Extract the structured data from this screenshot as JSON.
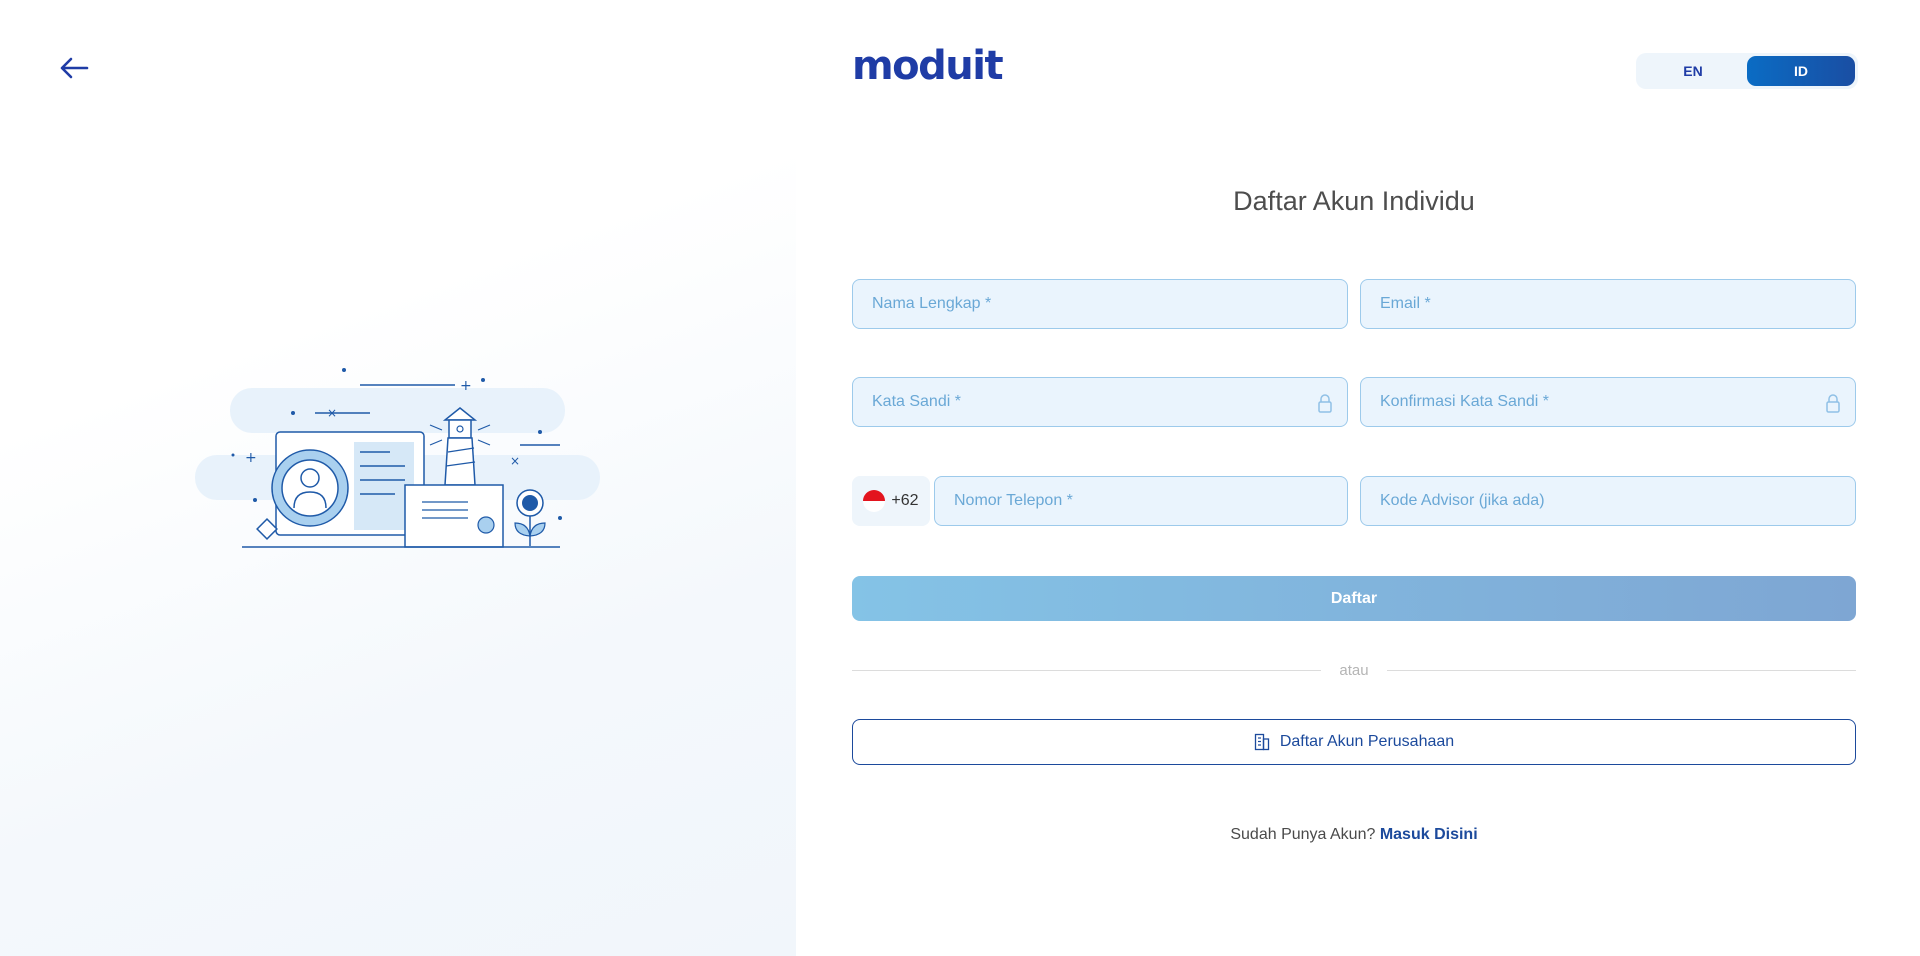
{
  "header": {
    "brand": "moduit",
    "languages": [
      {
        "label": "EN",
        "active": false
      },
      {
        "label": "ID",
        "active": true
      }
    ]
  },
  "form": {
    "title": "Daftar Akun Individu",
    "full_name_placeholder": "Nama Lengkap *",
    "email_placeholder": "Email *",
    "password_placeholder": "Kata Sandi *",
    "confirm_password_placeholder": "Konfirmasi Kata Sandi *",
    "country_code": "+62",
    "phone_placeholder": "Nomor Telepon *",
    "advisor_placeholder": "Kode Advisor (jika ada)",
    "submit_label": "Daftar",
    "divider_label": "atau",
    "company_button_label": "Daftar Akun Perusahaan",
    "login_prompt": "Sudah Punya Akun?",
    "login_link": "Masuk Disini"
  },
  "colors": {
    "brand_blue": "#1f3ca6",
    "input_bg": "#eaf4fd",
    "input_border": "#9dcaeb",
    "placeholder": "#6aa8d6",
    "submit_disabled": "#84c3e6"
  },
  "icons": {
    "back": "arrow-left-icon",
    "lock": "lock-icon",
    "flag": "indonesia-flag-icon",
    "company": "building-icon"
  }
}
